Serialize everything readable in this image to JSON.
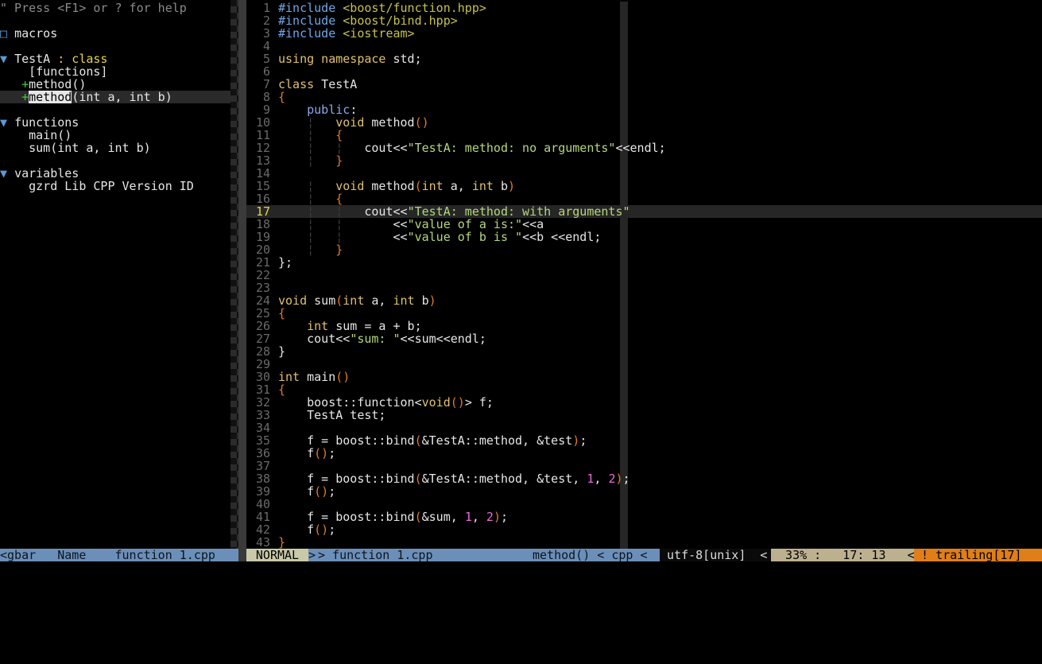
{
  "tagbar": {
    "lines": [
      {
        "help": "\" Press <F1> or ? for help"
      },
      {
        "text": ""
      },
      {
        "fold": "□ ",
        "tag": "macros"
      },
      {
        "text": ""
      },
      {
        "fold": "▼ ",
        "tag": "TestA",
        "kind": " : class"
      },
      {
        "indent": "    ",
        "tag": "[functions]"
      },
      {
        "indent": "   ",
        "plus": "+",
        "tag": "method",
        "scope": "()"
      },
      {
        "indent": "   ",
        "plus": "+",
        "tag": "method",
        "scope": "(int a, int b)",
        "highlight": true,
        "current": true
      },
      {
        "text": ""
      },
      {
        "fold": "▼ ",
        "tag": "functions"
      },
      {
        "indent": "    ",
        "tag": "main",
        "scope": "()"
      },
      {
        "indent": "    ",
        "tag": "sum",
        "scope": "(int a, int b)"
      },
      {
        "text": ""
      },
      {
        "fold": "▼ ",
        "tag": "variables"
      },
      {
        "indent": "    ",
        "tag": "gzrd_Lib_CPP_Version_ID"
      }
    ]
  },
  "editor": {
    "cursor_line": 17,
    "lines": [
      {
        "n": "1",
        "tokens": [
          [
            "pp",
            "#include "
          ],
          [
            "inc",
            "<boost/function.hpp>"
          ]
        ]
      },
      {
        "n": "2",
        "tokens": [
          [
            "pp",
            "#include "
          ],
          [
            "inc",
            "<boost/bind.hpp>"
          ]
        ]
      },
      {
        "n": "3",
        "tokens": [
          [
            "pp",
            "#include "
          ],
          [
            "inc",
            "<iostream>"
          ]
        ]
      },
      {
        "n": "4",
        "tokens": []
      },
      {
        "n": "5",
        "tokens": [
          [
            "kw",
            "using namespace"
          ],
          [
            "code",
            " std;"
          ]
        ]
      },
      {
        "n": "6",
        "tokens": []
      },
      {
        "n": "7",
        "tokens": [
          [
            "kw",
            "class"
          ],
          [
            "code",
            " TestA"
          ]
        ]
      },
      {
        "n": "8",
        "tokens": [
          [
            "br",
            "{"
          ]
        ]
      },
      {
        "n": "9",
        "tokens": [
          [
            "code",
            "    "
          ],
          [
            "acc",
            "public"
          ],
          [
            "code",
            ":"
          ]
        ]
      },
      {
        "n": "10",
        "tokens": [
          [
            "code",
            "    "
          ],
          [
            "guide",
            "¦"
          ],
          [
            "code",
            "   "
          ],
          [
            "typ",
            "void"
          ],
          [
            "code",
            " method"
          ],
          [
            "br",
            "()"
          ]
        ]
      },
      {
        "n": "11",
        "tokens": [
          [
            "code",
            "    "
          ],
          [
            "guide",
            "¦"
          ],
          [
            "code",
            "   "
          ],
          [
            "br",
            "{"
          ]
        ]
      },
      {
        "n": "12",
        "tokens": [
          [
            "code",
            "    "
          ],
          [
            "guide",
            "¦"
          ],
          [
            "code",
            "   "
          ],
          [
            "guide",
            "¦"
          ],
          [
            "code",
            "   cout<<"
          ],
          [
            "str",
            "\"TestA: method: no arguments\""
          ],
          [
            "code",
            "<<endl;"
          ]
        ]
      },
      {
        "n": "13",
        "tokens": [
          [
            "code",
            "    "
          ],
          [
            "guide",
            "¦"
          ],
          [
            "code",
            "   "
          ],
          [
            "br",
            "}"
          ]
        ]
      },
      {
        "n": "14",
        "tokens": []
      },
      {
        "n": "15",
        "tokens": [
          [
            "code",
            "    "
          ],
          [
            "guide",
            "¦"
          ],
          [
            "code",
            "   "
          ],
          [
            "typ",
            "void"
          ],
          [
            "code",
            " method"
          ],
          [
            "br",
            "("
          ],
          [
            "typ",
            "int"
          ],
          [
            "code",
            " a, "
          ],
          [
            "typ",
            "int"
          ],
          [
            "code",
            " b"
          ],
          [
            "br",
            ")"
          ]
        ]
      },
      {
        "n": "16",
        "tokens": [
          [
            "code",
            "    "
          ],
          [
            "guide",
            "¦"
          ],
          [
            "code",
            "   "
          ],
          [
            "br",
            "{"
          ]
        ]
      },
      {
        "n": "17",
        "tokens": [
          [
            "code",
            "    "
          ],
          [
            "guide",
            "¦"
          ],
          [
            "code",
            "   "
          ],
          [
            "guide",
            "¦"
          ],
          [
            "code",
            "   cout<<"
          ],
          [
            "str",
            "\"TestA: method: with arguments\""
          ]
        ]
      },
      {
        "n": "18",
        "tokens": [
          [
            "code",
            "    "
          ],
          [
            "guide",
            "¦"
          ],
          [
            "code",
            "   "
          ],
          [
            "guide",
            "¦"
          ],
          [
            "code",
            "       <<"
          ],
          [
            "str",
            "\"value of a is:\""
          ],
          [
            "code",
            "<<a"
          ]
        ]
      },
      {
        "n": "19",
        "tokens": [
          [
            "code",
            "    "
          ],
          [
            "guide",
            "¦"
          ],
          [
            "code",
            "   "
          ],
          [
            "guide",
            "¦"
          ],
          [
            "code",
            "       <<"
          ],
          [
            "str",
            "\"value of b is \""
          ],
          [
            "code",
            "<<b <<endl;"
          ]
        ]
      },
      {
        "n": "20",
        "tokens": [
          [
            "code",
            "    "
          ],
          [
            "guide",
            "¦"
          ],
          [
            "code",
            "   "
          ],
          [
            "br",
            "}"
          ]
        ]
      },
      {
        "n": "21",
        "tokens": [
          [
            "code",
            "};"
          ]
        ]
      },
      {
        "n": "22",
        "tokens": []
      },
      {
        "n": "23",
        "tokens": []
      },
      {
        "n": "24",
        "tokens": [
          [
            "typ",
            "void"
          ],
          [
            "code",
            " sum"
          ],
          [
            "br",
            "("
          ],
          [
            "typ",
            "int"
          ],
          [
            "code",
            " a, "
          ],
          [
            "typ",
            "int"
          ],
          [
            "code",
            " b"
          ],
          [
            "br",
            ")"
          ]
        ]
      },
      {
        "n": "25",
        "tokens": [
          [
            "br",
            "{"
          ]
        ]
      },
      {
        "n": "26",
        "tokens": [
          [
            "code",
            "    "
          ],
          [
            "typ",
            "int"
          ],
          [
            "code",
            " sum = a + b;"
          ]
        ]
      },
      {
        "n": "27",
        "tokens": [
          [
            "code",
            "    cout<<"
          ],
          [
            "str",
            "\"sum: \""
          ],
          [
            "code",
            "<<sum<<endl;"
          ]
        ]
      },
      {
        "n": "28",
        "tokens": [
          [
            "code",
            "}"
          ]
        ]
      },
      {
        "n": "29",
        "tokens": []
      },
      {
        "n": "30",
        "tokens": [
          [
            "typ",
            "int"
          ],
          [
            "code",
            " main"
          ],
          [
            "br",
            "()"
          ]
        ]
      },
      {
        "n": "31",
        "tokens": [
          [
            "br",
            "{"
          ]
        ]
      },
      {
        "n": "32",
        "tokens": [
          [
            "code",
            "    boost::function<"
          ],
          [
            "typ",
            "void"
          ],
          [
            "br",
            "()"
          ],
          [
            "code",
            "> f;"
          ]
        ]
      },
      {
        "n": "33",
        "tokens": [
          [
            "code",
            "    TestA test;"
          ]
        ]
      },
      {
        "n": "34",
        "tokens": []
      },
      {
        "n": "35",
        "tokens": [
          [
            "code",
            "    f = boost::bind"
          ],
          [
            "br",
            "("
          ],
          [
            "code",
            "&TestA::method, &test"
          ],
          [
            "br",
            ")"
          ],
          [
            "code",
            ";"
          ]
        ]
      },
      {
        "n": "36",
        "tokens": [
          [
            "code",
            "    f"
          ],
          [
            "br",
            "()"
          ],
          [
            "code",
            ";"
          ]
        ]
      },
      {
        "n": "37",
        "tokens": []
      },
      {
        "n": "38",
        "tokens": [
          [
            "code",
            "    f = boost::bind"
          ],
          [
            "br",
            "("
          ],
          [
            "code",
            "&TestA::method, &test, "
          ],
          [
            "num",
            "1"
          ],
          [
            "code",
            ", "
          ],
          [
            "num",
            "2"
          ],
          [
            "br",
            ")"
          ],
          [
            "code",
            ";"
          ]
        ]
      },
      {
        "n": "39",
        "tokens": [
          [
            "code",
            "    f"
          ],
          [
            "br",
            "()"
          ],
          [
            "code",
            ";"
          ]
        ]
      },
      {
        "n": "40",
        "tokens": []
      },
      {
        "n": "41",
        "tokens": [
          [
            "code",
            "    f = boost::bind"
          ],
          [
            "br",
            "("
          ],
          [
            "code",
            "&sum, "
          ],
          [
            "num",
            "1"
          ],
          [
            "code",
            ", "
          ],
          [
            "num",
            "2"
          ],
          [
            "br",
            ")"
          ],
          [
            "code",
            ";"
          ]
        ]
      },
      {
        "n": "42",
        "tokens": [
          [
            "code",
            "    f"
          ],
          [
            "br",
            "()"
          ],
          [
            "code",
            ";"
          ]
        ]
      },
      {
        "n": "43",
        "tokens": [
          [
            "br",
            "}"
          ]
        ]
      }
    ]
  },
  "status": {
    "left": "<gbar   Name    function_1.cpp",
    "mode": "NORMAL",
    "arrow": ">",
    "file": "> function_1.cpp",
    "tag_scope": "method() < cpp <",
    "encoding": " utf-8[unix]  <",
    "position": "  33% :   17: 13   <",
    "warning": " ! trailing[17]"
  },
  "colors": {
    "status_blue": "#6b8fb8",
    "mode_bg": "#c9c9a9",
    "position_bg": "#bdb08f",
    "warning_bg": "#e07e18",
    "string": "#b5d77c",
    "number": "#e96cd8",
    "keyword": "#e0c070",
    "preproc": "#6fa8e8"
  }
}
